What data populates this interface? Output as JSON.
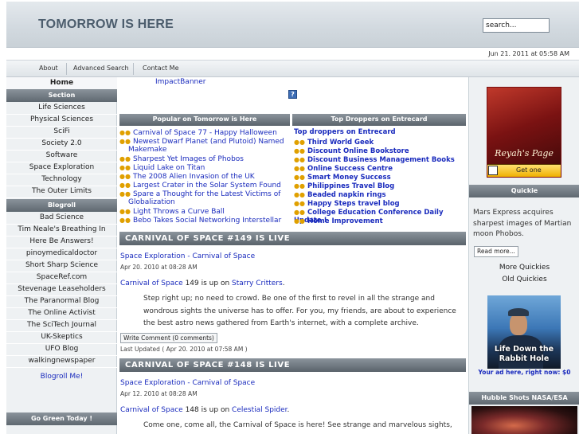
{
  "header": {
    "title": "TOMORROW IS HERE",
    "search_value": "search..."
  },
  "datebar": {
    "datetime": "Jun 21. 2011 at 05:58 AM"
  },
  "nav": {
    "items": [
      "About",
      "Advanced Search",
      "Contact Me"
    ]
  },
  "sidebar": {
    "home": "Home",
    "section_title": "Section",
    "sections": [
      "Life Sciences",
      "Physical Sciences",
      "SciFi",
      "Society 2.0",
      "Software",
      "Space Exploration",
      "Technology",
      "The Outer Limits"
    ],
    "blogroll_title": "Blogroll",
    "blogroll": [
      "Bad Science",
      "Tim Neale's Breathing In",
      "Here Be Answers!",
      "pinoymedicaldoctor",
      "Short Sharp Science",
      "SpaceRef.com",
      "Stevenage Leaseholders",
      "The Paranormal Blog",
      "The Online Activist",
      "The SciTech Journal",
      "UK-Skeptics",
      "UFO Blog",
      "walkingnewspaper"
    ],
    "blogroll_me": "Blogroll Me!",
    "go_green_title": "Go Green Today !"
  },
  "main": {
    "impact_banner": "ImpactBanner",
    "help_icon_char": "?",
    "popular": {
      "title": "Popular on Tomorrow is Here",
      "items": [
        "Carnival of Space 77 - Happy Halloween",
        "Newest Dwarf Planet (and Plutoid) Named Makemake",
        "Sharpest Yet Images of Phobos",
        "Liquid Lake on Titan",
        "The 2008 Alien Invasion of the UK",
        "Largest Crater in the Solar System Found",
        "Spare a Thought for the Latest Victims of Globalization",
        "Light Throws a Curve Ball",
        "Bebo Takes Social Networking Interstellar"
      ]
    },
    "droppers": {
      "title": "Top Droppers on Entrecard",
      "subtitle": "Top droppers on Entrecard",
      "items": [
        "Third World Geek",
        "Discount Online Bookstore",
        "Discount Business Management Books",
        "Online Success Centre",
        "Smart Money Success",
        "Philippines Travel Blog",
        "Beaded napkin rings",
        "Happy Steps travel blog",
        "College Education Conference Daily Update !",
        "Home Improvement"
      ]
    },
    "posts": [
      {
        "title": "CARNIVAL OF SPACE #149 IS LIVE",
        "category": "Space Exploration - Carnival of Space",
        "date": "Apr 20. 2010 at 08:28 AM",
        "lead_link": "Carnival of Space",
        "lead_mid": " 149 is up on ",
        "lead_host": "Starry Critters",
        "lead_end": ".",
        "body": "Step right up; no need to crowd. Be one of the first to revel in all the strange and wondrous sights the universe has to offer. For you, my friends, are about to experience the best astro news gathered from Earth's internet, with a complete archive.",
        "comment_btn": "Write Comment (0 comments)",
        "updated": "Last Updated ( Apr 20. 2010 at 07:58 AM )"
      },
      {
        "title": "CARNIVAL OF SPACE #148 IS LIVE",
        "category": "Space Exploration - Carnival of Space",
        "date": "Apr 12. 2010 at 08:28 AM",
        "lead_link": "Carnival of Space",
        "lead_mid": " 148 is up on ",
        "lead_host": "Celestial Spider",
        "lead_end": ".",
        "body": "Come one, come all, the Carnival of Space is here! See strange and marvelous sights, explore"
      }
    ]
  },
  "right": {
    "reyah_title": "Reyah's Page",
    "reyah_get": "Get one",
    "quickie_title": "Quickie",
    "quickie_text": "Mars Express acquires sharpest images of Martian moon Phobos.",
    "read_more": "Read more...",
    "more_quickies": "More Quickies",
    "old_quickies": "Old Quickies",
    "rabbit_title": "Life Down the Rabbit Hole",
    "rabbit_ad": "Your ad here, right now: $0",
    "hubble_title": "Hubble Shots NASA/ESA"
  },
  "colors": {
    "link": "#1a2bbd",
    "header_bar": "#6b747c",
    "arrow": "#e0a000"
  }
}
